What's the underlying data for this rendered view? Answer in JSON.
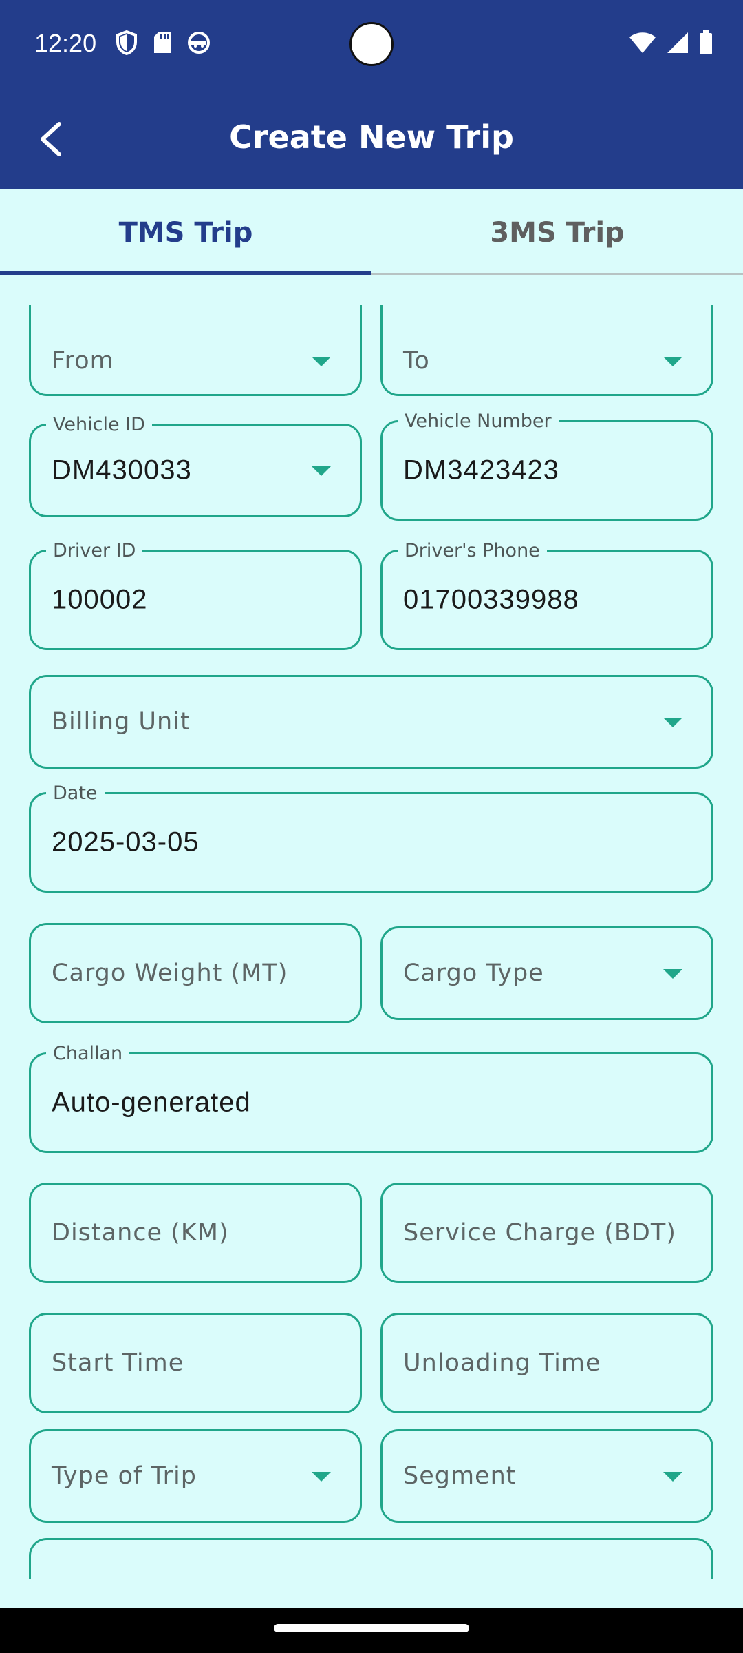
{
  "status_bar": {
    "time": "12:20"
  },
  "header": {
    "title": "Create New Trip"
  },
  "tabs": [
    {
      "label": "TMS Trip",
      "active": true
    },
    {
      "label": "3MS Trip",
      "active": false
    }
  ],
  "form": {
    "from": {
      "placeholder": "From"
    },
    "to": {
      "placeholder": "To"
    },
    "vehicle_id": {
      "label": "Vehicle ID",
      "value": "DM430033"
    },
    "vehicle_number": {
      "label": "Vehicle Number",
      "value": "DM3423423"
    },
    "driver_id": {
      "label": "Driver ID",
      "value": "100002"
    },
    "driver_phone": {
      "label": "Driver's Phone",
      "value": "01700339988"
    },
    "billing_unit": {
      "placeholder": "Billing Unit"
    },
    "date": {
      "label": "Date",
      "value": "2025-03-05"
    },
    "cargo_weight": {
      "placeholder": "Cargo Weight (MT)"
    },
    "cargo_type": {
      "placeholder": "Cargo Type"
    },
    "challan": {
      "label": "Challan",
      "value": "Auto-generated"
    },
    "distance": {
      "placeholder": "Distance (KM)"
    },
    "service_charge": {
      "placeholder": "Service Charge (BDT)"
    },
    "start_time": {
      "placeholder": "Start Time"
    },
    "unloading_time": {
      "placeholder": "Unloading Time"
    },
    "type_of_trip": {
      "placeholder": "Type of Trip"
    },
    "segment": {
      "placeholder": "Segment"
    }
  },
  "colors": {
    "app_bar": "#233d8b",
    "background": "#dafcfb",
    "accent": "#20a68a",
    "tab_inactive": "#5f5f5f"
  }
}
